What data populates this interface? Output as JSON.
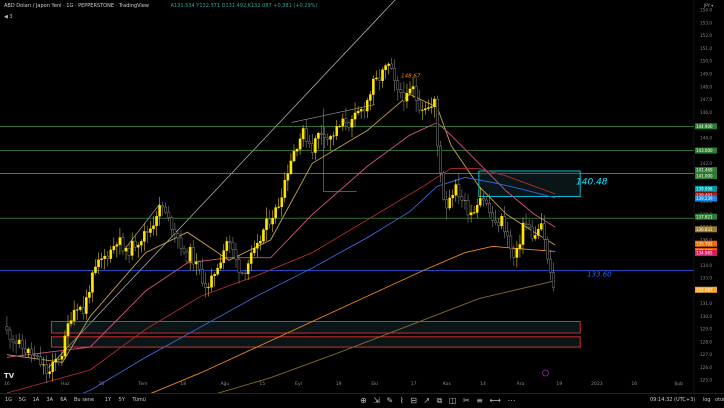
{
  "header": {
    "title": "ABD Doları / Japon Yeni · 1G · PEPPERSTONE · TradingView",
    "ohlc": "A131.534 Y132.371 D131.492 K132.087 +0.381 (+0.29%)",
    "symbol_marker": "◀ 3",
    "currency": "JPY ▾"
  },
  "bottom": {
    "timeframes": [
      "1G",
      "5G",
      "1A",
      "3A",
      "6A",
      "Bu sene",
      "1Y",
      "5Y",
      "Tümü"
    ],
    "clock": "09:14:32 (UTC+3)",
    "log": "log",
    "auto": "otomatik"
  },
  "chart_data": {
    "type": "candlestick",
    "symbol": "USDJPY",
    "ylim": [
      124.0,
      154.8
    ],
    "y_ticks": [
      125,
      126,
      127,
      128,
      129,
      130,
      131,
      132,
      133,
      134,
      135,
      136,
      137,
      138,
      139,
      140,
      141,
      142,
      143,
      144,
      145,
      146,
      147,
      148,
      149,
      150,
      151,
      152,
      153,
      154
    ],
    "x_tick_labels": [
      {
        "label": "16",
        "t": 0
      },
      {
        "label": "Haz",
        "t": 42
      },
      {
        "label": "20",
        "t": 68
      },
      {
        "label": "Tem",
        "t": 98
      },
      {
        "label": "18",
        "t": 127
      },
      {
        "label": "Ağu",
        "t": 157
      },
      {
        "label": "15",
        "t": 184
      },
      {
        "label": "Eyl",
        "t": 210
      },
      {
        "label": "19",
        "t": 239
      },
      {
        "label": "Eki",
        "t": 265
      },
      {
        "label": "17",
        "t": 293
      },
      {
        "label": "Kas",
        "t": 317
      },
      {
        "label": "14",
        "t": 343
      },
      {
        "label": "Ara",
        "t": 370
      },
      {
        "label": "19",
        "t": 398
      },
      {
        "label": "2023",
        "t": 425
      },
      {
        "label": "16",
        "t": 452
      },
      {
        "label": "Şub",
        "t": 484
      }
    ],
    "close_path": [
      [
        0,
        128.8
      ],
      [
        10,
        127.6
      ],
      [
        18,
        127.0
      ],
      [
        25,
        126.2
      ],
      [
        30,
        125.4
      ],
      [
        35,
        126.5
      ],
      [
        40,
        127.2
      ],
      [
        45,
        129.8
      ],
      [
        50,
        131.0
      ],
      [
        55,
        130.4
      ],
      [
        60,
        132.5
      ],
      [
        65,
        134.0
      ],
      [
        70,
        134.6
      ],
      [
        75,
        135.2
      ],
      [
        80,
        136.2
      ],
      [
        85,
        134.8
      ],
      [
        90,
        135.5
      ],
      [
        95,
        136.0
      ],
      [
        100,
        136.5
      ],
      [
        105,
        137.2
      ],
      [
        108,
        138.2
      ],
      [
        112,
        138.6
      ],
      [
        116,
        137.6
      ],
      [
        120,
        137.0
      ],
      [
        125,
        135.8
      ],
      [
        128,
        134.5
      ],
      [
        132,
        135.0
      ],
      [
        136,
        134.0
      ],
      [
        140,
        133.2
      ],
      [
        145,
        132.0
      ],
      [
        150,
        133.6
      ],
      [
        155,
        134.8
      ],
      [
        158,
        136.0
      ],
      [
        162,
        135.4
      ],
      [
        166,
        134.0
      ],
      [
        170,
        133.4
      ],
      [
        175,
        134.5
      ],
      [
        180,
        135.2
      ],
      [
        185,
        136.8
      ],
      [
        190,
        137.8
      ],
      [
        195,
        138.5
      ],
      [
        200,
        140.6
      ],
      [
        205,
        142.5
      ],
      [
        210,
        143.8
      ],
      [
        213,
        144.4
      ],
      [
        216,
        144.0
      ],
      [
        220,
        143.2
      ],
      [
        224,
        144.2
      ],
      [
        228,
        144.6
      ],
      [
        232,
        143.8
      ],
      [
        236,
        144.4
      ],
      [
        240,
        144.9
      ],
      [
        244,
        145.4
      ],
      [
        248,
        145.0
      ],
      [
        252,
        145.8
      ],
      [
        256,
        146.2
      ],
      [
        260,
        147.0
      ],
      [
        264,
        148.2
      ],
      [
        268,
        148.6
      ],
      [
        272,
        149.3
      ],
      [
        275,
        149.6
      ],
      [
        278,
        148.9
      ],
      [
        281,
        147.4
      ],
      [
        284,
        147.6
      ],
      [
        288,
        147.0
      ],
      [
        292,
        148.0
      ],
      [
        295,
        147.0
      ],
      [
        298,
        146.4
      ],
      [
        301,
        146.6
      ],
      [
        305,
        146.2
      ],
      [
        308,
        146.8
      ],
      [
        310,
        143.5
      ],
      [
        312,
        142.0
      ],
      [
        314,
        139.5
      ],
      [
        317,
        138.7
      ],
      [
        320,
        139.8
      ],
      [
        324,
        140.0
      ],
      [
        328,
        139.2
      ],
      [
        332,
        138.4
      ],
      [
        336,
        138.2
      ],
      [
        340,
        139.5
      ],
      [
        344,
        139.2
      ],
      [
        348,
        138.0
      ],
      [
        352,
        137.0
      ],
      [
        356,
        137.7
      ],
      [
        360,
        136.6
      ],
      [
        363,
        135.2
      ],
      [
        366,
        134.3
      ],
      [
        369,
        135.6
      ],
      [
        372,
        137.4
      ],
      [
        376,
        136.9
      ],
      [
        380,
        136.0
      ],
      [
        384,
        137.3
      ],
      [
        387,
        136.2
      ],
      [
        390,
        133.9
      ],
      [
        392,
        133.0
      ],
      [
        395,
        132.1
      ]
    ],
    "moving_averages": [
      {
        "name": "MA short",
        "color": "#c2a24a",
        "path": [
          [
            0,
            127.0
          ],
          [
            40,
            126.4
          ],
          [
            60,
            130.0
          ],
          [
            100,
            135.0
          ],
          [
            130,
            136.6
          ],
          [
            160,
            134.4
          ],
          [
            190,
            136.0
          ],
          [
            220,
            142.0
          ],
          [
            260,
            144.6
          ],
          [
            290,
            147.4
          ],
          [
            310,
            146.4
          ],
          [
            320,
            143.4
          ],
          [
            340,
            140.2
          ],
          [
            360,
            138.0
          ],
          [
            380,
            136.6
          ],
          [
            395,
            135.6
          ]
        ]
      },
      {
        "name": "MA medium",
        "color": "#d4537e",
        "path": [
          [
            0,
            126.8
          ],
          [
            60,
            127.6
          ],
          [
            100,
            132.0
          ],
          [
            130,
            134.2
          ],
          [
            160,
            134.6
          ],
          [
            190,
            134.6
          ],
          [
            220,
            138.0
          ],
          [
            260,
            141.8
          ],
          [
            290,
            144.2
          ],
          [
            310,
            145.2
          ],
          [
            320,
            144.2
          ],
          [
            340,
            142.0
          ],
          [
            360,
            139.8
          ],
          [
            380,
            138.0
          ],
          [
            395,
            137.0
          ]
        ]
      },
      {
        "name": "MA long",
        "color": "#b02d2d",
        "path": [
          [
            0,
            124.0
          ],
          [
            60,
            125.8
          ],
          [
            100,
            129.0
          ],
          [
            140,
            131.6
          ],
          [
            180,
            133.2
          ],
          [
            220,
            135.0
          ],
          [
            260,
            137.6
          ],
          [
            300,
            140.2
          ],
          [
            320,
            141.6
          ],
          [
            340,
            141.6
          ],
          [
            360,
            141.0
          ],
          [
            380,
            140.2
          ],
          [
            395,
            139.6
          ]
        ]
      },
      {
        "name": "MA 100",
        "color": "#3a66d6",
        "path": [
          [
            20,
            122.5
          ],
          [
            60,
            124.2
          ],
          [
            100,
            126.8
          ],
          [
            140,
            129.2
          ],
          [
            180,
            131.6
          ],
          [
            220,
            133.8
          ],
          [
            260,
            136.2
          ],
          [
            290,
            138.2
          ],
          [
            310,
            140.2
          ],
          [
            330,
            140.9
          ],
          [
            350,
            140.5
          ],
          [
            370,
            140.0
          ],
          [
            395,
            139.3
          ]
        ]
      },
      {
        "name": "MA 200",
        "color": "#f08a1c",
        "path": [
          [
            40,
            122.0
          ],
          [
            100,
            123.8
          ],
          [
            140,
            125.6
          ],
          [
            180,
            127.6
          ],
          [
            220,
            129.6
          ],
          [
            260,
            131.6
          ],
          [
            300,
            133.6
          ],
          [
            330,
            135.0
          ],
          [
            350,
            135.5
          ],
          [
            370,
            135.3
          ],
          [
            395,
            135.1
          ]
        ]
      },
      {
        "name": "MA 200 dim",
        "color": "#8a6a2a",
        "path": [
          [
            80,
            122.0
          ],
          [
            140,
            123.6
          ],
          [
            190,
            125.2
          ],
          [
            240,
            127.2
          ],
          [
            290,
            129.3
          ],
          [
            340,
            131.4
          ],
          [
            395,
            132.8
          ]
        ]
      }
    ],
    "horizontal_levels": [
      {
        "price": 144.9,
        "color": "#4caf50"
      },
      {
        "price": 143.0,
        "color": "#4caf50"
      },
      {
        "price": 141.2,
        "color": "#4caf50"
      },
      {
        "price": 137.7,
        "color": "#4caf50"
      },
      {
        "price": 133.6,
        "color": "#2962ff"
      }
    ],
    "annotations": [
      {
        "text": "148.67",
        "color": "#f08a1c",
        "t": 284,
        "price": 148.9
      },
      {
        "text": "140.48",
        "color": "#00e5ff",
        "t": 410,
        "price": 140.48
      },
      {
        "text": "133.60",
        "color": "#2962ff",
        "t": 418,
        "price": 133.3
      }
    ],
    "boxes": [
      {
        "t0": 340,
        "t1": 413,
        "price_top": 141.4,
        "price_bottom": 139.4,
        "color": "#00e5ff"
      },
      {
        "t0": 32,
        "t1": 413,
        "price_top": 129.6,
        "price_bottom": 128.7,
        "color": "#ff3b3b"
      },
      {
        "t0": 32,
        "t1": 413,
        "price_top": 128.4,
        "price_bottom": 127.6,
        "color": "#ff3b3b"
      }
    ],
    "price_labels": [
      {
        "text": "144.900",
        "price": 144.9,
        "bg": "#2e7d32"
      },
      {
        "text": "143.000",
        "price": 143.0,
        "bg": "#2e7d32"
      },
      {
        "text": "141.469",
        "price": 141.47,
        "bg": "#2e7d32"
      },
      {
        "text": "141.000",
        "price": 141.0,
        "bg": "#2e7d32"
      },
      {
        "text": "139.998",
        "price": 140.0,
        "bg": "#0097a7"
      },
      {
        "text": "139.491",
        "price": 139.49,
        "bg": "#b71c1c"
      },
      {
        "text": "139.239",
        "price": 139.24,
        "bg": "#1e88e5"
      },
      {
        "text": "137.821",
        "price": 137.82,
        "bg": "#2e7d32"
      },
      {
        "text": "136.831",
        "price": 136.83,
        "bg": "#9e7a2e"
      },
      {
        "text": "135.702",
        "price": 135.7,
        "bg": "#ef6c00"
      },
      {
        "text": "135.121",
        "price": 135.12,
        "bg": "#ef6c00"
      },
      {
        "text": "134.965",
        "price": 134.97,
        "bg": "#d81b60"
      },
      {
        "text": "132.087",
        "price": 132.09,
        "bg": "#f9a825"
      }
    ]
  }
}
